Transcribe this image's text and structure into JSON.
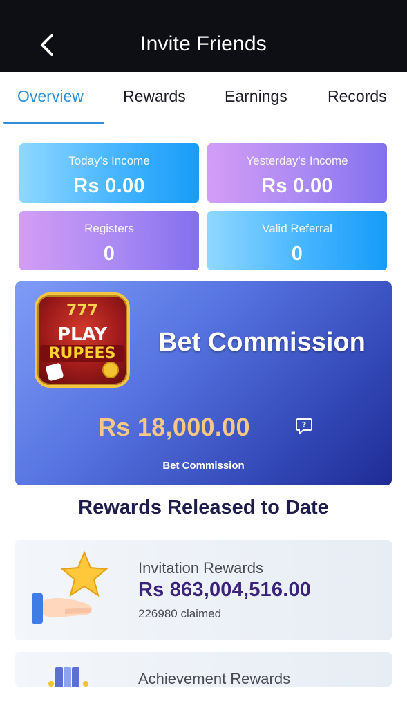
{
  "header": {
    "title": "Invite Friends",
    "back_icon": "chevron-left-icon"
  },
  "tabs": [
    {
      "label": "Overview",
      "active": true
    },
    {
      "label": "Rewards",
      "active": false
    },
    {
      "label": "Earnings",
      "active": false
    },
    {
      "label": "Records",
      "active": false
    }
  ],
  "stats": [
    {
      "label": "Today's Income",
      "value": "Rs 0.00"
    },
    {
      "label": "Yesterday's Income",
      "value": "Rs 0.00"
    },
    {
      "label": "Registers",
      "value": "0"
    },
    {
      "label": "Valid Referral",
      "value": "0"
    }
  ],
  "bet_commission": {
    "logo": {
      "sevens": "777",
      "word1": "PLAY",
      "word2": "RUPEES"
    },
    "title": "Bet Commission",
    "amount": "Rs 18,000.00",
    "subtitle": "Bet Commission",
    "help_icon": "question-bubble-icon"
  },
  "rewards_section": {
    "title": "Rewards Released to Date",
    "items": [
      {
        "title": "Invitation Rewards",
        "amount": "Rs 863,004,516.00",
        "claimed": "226980 claimed",
        "icon": "star-hand-icon"
      },
      {
        "title": "Achievement Rewards",
        "icon": "trophy-icon"
      }
    ]
  },
  "colors": {
    "accent": "#2d8ed6",
    "header_bg": "#0d0f14",
    "amount_gold": "#f7c783",
    "reward_amount": "#3b237a"
  }
}
